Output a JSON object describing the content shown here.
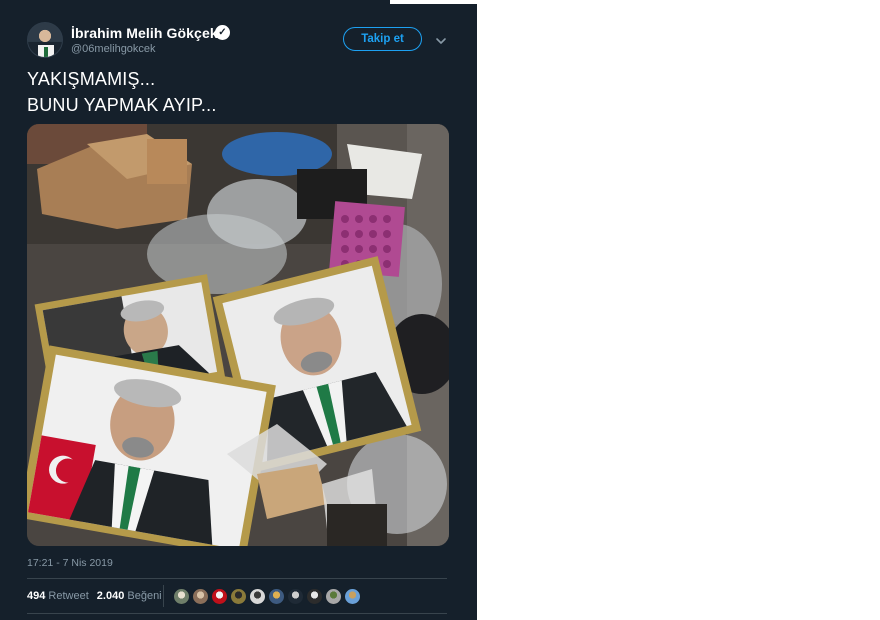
{
  "tweet": {
    "author": {
      "display_name": "İbrahim Melih Gökçek",
      "handle": "@06melihgokcek",
      "verified": true,
      "verified_glyph": "✓"
    },
    "follow_button_label": "Takip et",
    "more_icon": "chevron-down-icon",
    "text": "YAKIŞMAMIŞ...\nBUNU YAPMAK AYIP...",
    "photo": {
      "description_icon": "photo"
    },
    "timestamp": "17:21 - 7 Nis 2019",
    "stats": {
      "retweets_count": "494",
      "retweets_label": "Retweet",
      "likes_count": "2.040",
      "likes_label": "Beğeni"
    },
    "liker_avatars": [
      {
        "colors": [
          "#6f7f6a",
          "#e8e0d0"
        ]
      },
      {
        "colors": [
          "#8b6f5a",
          "#d9c3a8"
        ]
      },
      {
        "colors": [
          "#c0101a",
          "#f4f4f4"
        ]
      },
      {
        "colors": [
          "#8a7a3a",
          "#2a2a2a"
        ]
      },
      {
        "colors": [
          "#d8d8d8",
          "#3a3a3a"
        ]
      },
      {
        "colors": [
          "#3d5a80",
          "#e0b050"
        ]
      },
      {
        "colors": [
          "#1f2a36",
          "#cfcfcf"
        ]
      },
      {
        "colors": [
          "#2c2c2c",
          "#e8e8e8"
        ]
      },
      {
        "colors": [
          "#a8a8a8",
          "#5a7a3a"
        ]
      },
      {
        "colors": [
          "#6aa0d8",
          "#c8a060"
        ]
      }
    ]
  },
  "colors": {
    "background": "#15202b",
    "accent": "#1da1f2",
    "muted_text": "#8899a6",
    "divider": "#38444d"
  }
}
